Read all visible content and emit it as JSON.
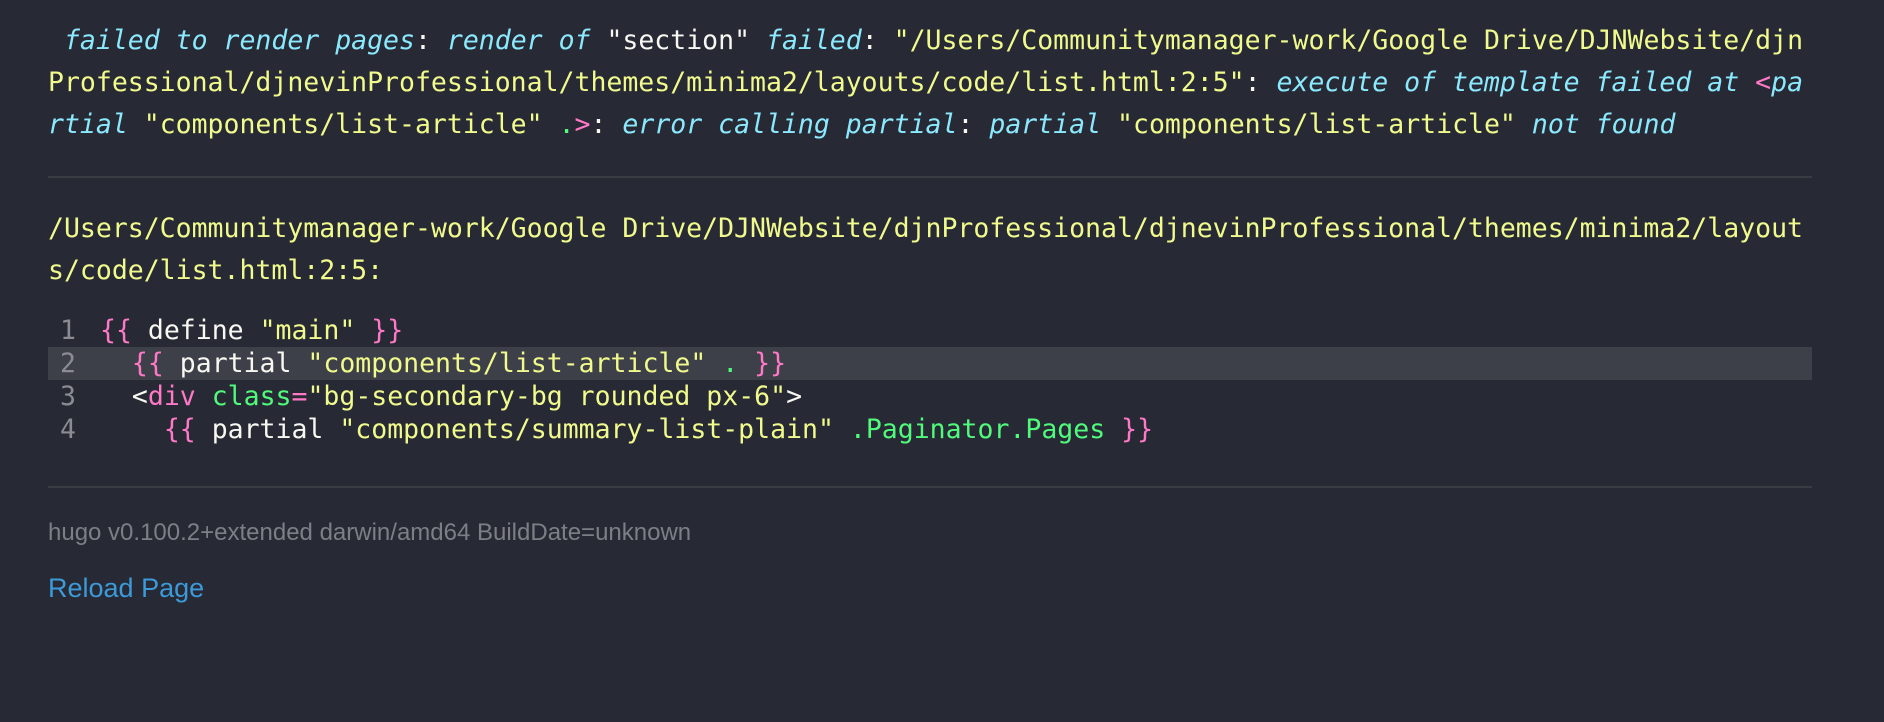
{
  "error": {
    "segments": [
      {
        "t": " failed to render pages",
        "c": "i"
      },
      {
        "t": ": ",
        "c": "w"
      },
      {
        "t": "render of ",
        "c": "i"
      },
      {
        "t": "\"section\" ",
        "c": "w"
      },
      {
        "t": "failed",
        "c": "i"
      },
      {
        "t": ": ",
        "c": "w"
      },
      {
        "t": "\"/Users/Communitymanager-work/Google Drive/DJNWebsite/djnProfessional/djnevinProfessional/themes/minima2/layouts/code/list.html:2:5\"",
        "c": "y"
      },
      {
        "t": ": ",
        "c": "w"
      },
      {
        "t": "execute of template failed at ",
        "c": "i"
      },
      {
        "t": "<",
        "c": "p"
      },
      {
        "t": "partial ",
        "c": "i"
      },
      {
        "t": "\"components/list-article\" ",
        "c": "y"
      },
      {
        "t": ".",
        "c": "g"
      },
      {
        "t": ">",
        "c": "p"
      },
      {
        "t": ": ",
        "c": "w"
      },
      {
        "t": "error calling partial",
        "c": "i"
      },
      {
        "t": ": ",
        "c": "w"
      },
      {
        "t": "partial ",
        "c": "i"
      },
      {
        "t": "\"components/list-article\" ",
        "c": "y"
      },
      {
        "t": "not found",
        "c": "i"
      }
    ]
  },
  "file_location": "/Users/Communitymanager-work/Google Drive/DJNWebsite/djnProfessional/djnevinProfessional/themes/minima2/layouts/code/list.html:2:5:",
  "code": {
    "highlighted_line": 2,
    "lines": [
      {
        "num": "1",
        "tokens": [
          {
            "t": "{{ ",
            "c": "p"
          },
          {
            "t": "define ",
            "c": "w"
          },
          {
            "t": "\"main\" ",
            "c": "y"
          },
          {
            "t": "}}",
            "c": "p"
          }
        ]
      },
      {
        "num": "2",
        "tokens": [
          {
            "t": "  {{ ",
            "c": "p"
          },
          {
            "t": "partial ",
            "c": "w"
          },
          {
            "t": "\"components/list-article\" ",
            "c": "y"
          },
          {
            "t": ". ",
            "c": "g"
          },
          {
            "t": "}}",
            "c": "p"
          }
        ]
      },
      {
        "num": "3",
        "tokens": [
          {
            "t": "  <",
            "c": "w"
          },
          {
            "t": "div ",
            "c": "p"
          },
          {
            "t": "class",
            "c": "g"
          },
          {
            "t": "=",
            "c": "p"
          },
          {
            "t": "\"bg-secondary-bg rounded px-6\"",
            "c": "y"
          },
          {
            "t": ">",
            "c": "w"
          }
        ]
      },
      {
        "num": "4",
        "tokens": [
          {
            "t": "    {{ ",
            "c": "p"
          },
          {
            "t": "partial ",
            "c": "w"
          },
          {
            "t": "\"components/summary-list-plain\" ",
            "c": "y"
          },
          {
            "t": ".Paginator.Pages ",
            "c": "g"
          },
          {
            "t": "}}",
            "c": "p"
          }
        ]
      }
    ]
  },
  "footer": {
    "version": "hugo v0.100.2+extended darwin/amd64 BuildDate=unknown",
    "reload_label": "Reload Page"
  },
  "colors": {
    "background": "#272935",
    "italic_keyword": "#8be9fd",
    "string": "#f1fa8c",
    "punctuation": "#ff79c6",
    "identifier": "#50fa7b",
    "link": "#3c9ad8"
  }
}
